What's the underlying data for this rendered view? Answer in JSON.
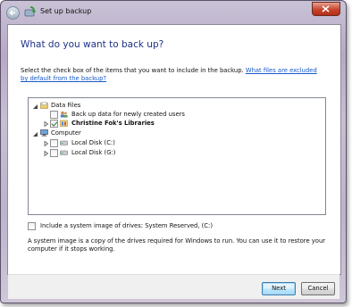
{
  "window": {
    "title": "Set up backup",
    "heading": "What do you want to back up?",
    "instruction": "Select the check box of the items that you want to include in the backup. ",
    "instruction_link": "What files are excluded by default from the backup?"
  },
  "tree": {
    "data_files": {
      "label": "Data Files",
      "expanded": true
    },
    "new_users": {
      "label": "Back up data for newly created users",
      "checked": false
    },
    "libraries": {
      "label": "Christine Fok's Libraries",
      "checked": true
    },
    "computer": {
      "label": "Computer",
      "expanded": true
    },
    "disk_c": {
      "label": "Local Disk (C:)",
      "checked": false
    },
    "disk_g": {
      "label": "Local Disk (G:)",
      "checked": false
    }
  },
  "system_image": {
    "label": "Include a system image of drives: System Reserved, (C:)",
    "checked": false,
    "description": "A system image is a copy of the drives required for Windows to run. You can use it to restore your computer if it stops working."
  },
  "buttons": {
    "next": "Next",
    "cancel": "Cancel"
  },
  "colors": {
    "heading": "#1e3287",
    "link": "#1558c8"
  }
}
